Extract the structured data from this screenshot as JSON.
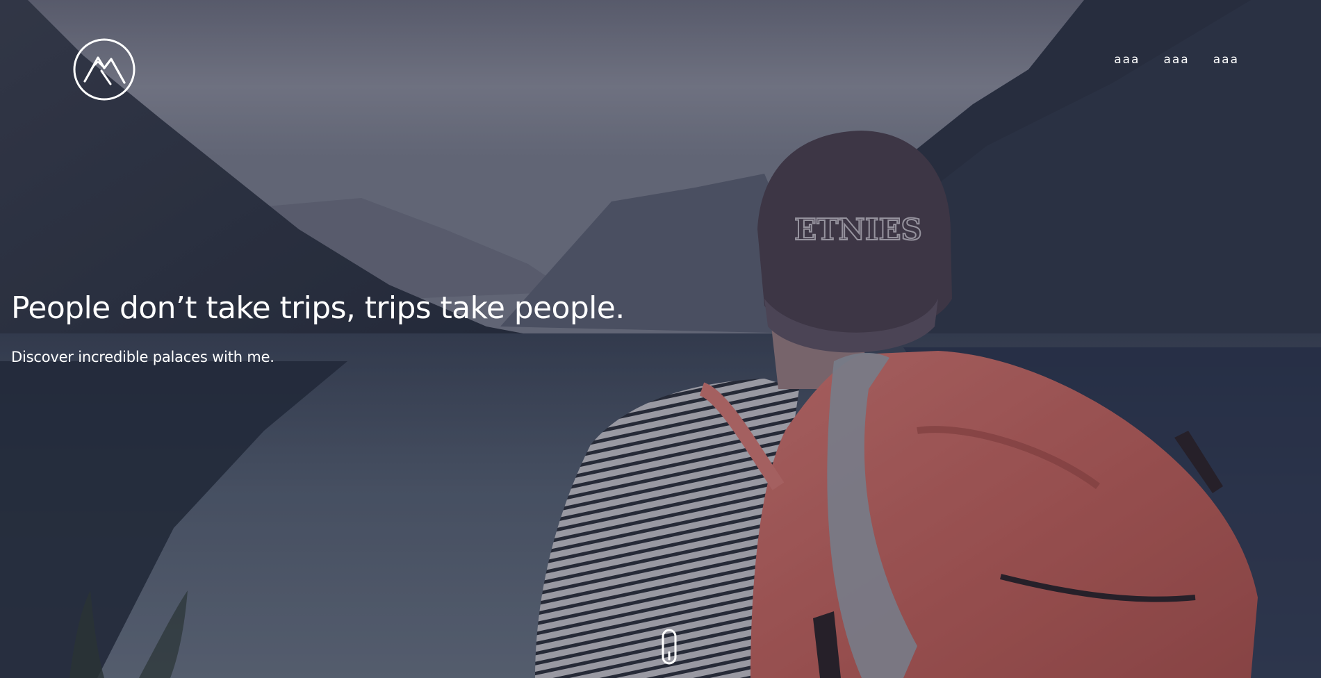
{
  "nav": {
    "items": [
      {
        "label": "aaa"
      },
      {
        "label": "aaa"
      },
      {
        "label": "aaa"
      }
    ]
  },
  "hero": {
    "headline": "People don’t take trips, trips take people.",
    "subheadline": "Discover incredible palaces with me.",
    "cap_text": "ETNIES"
  },
  "icons": {
    "logo": "mountain-logo-icon",
    "scroll": "scroll-down-icon"
  },
  "colors": {
    "overlay": "#1e2536",
    "backpack": "#c96a63",
    "text": "#ffffff",
    "sky": "#8a8c9b"
  }
}
